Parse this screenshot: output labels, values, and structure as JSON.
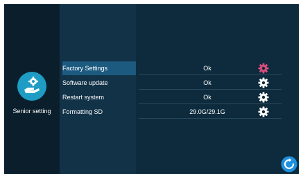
{
  "sidebar": {
    "label": "Senior setting",
    "icon": "settings-hand-icon"
  },
  "rows": [
    {
      "label": "Factory Settings",
      "value": "Ok",
      "icon": "gear-icon",
      "selected": true,
      "icon_color": "#d94c7a"
    },
    {
      "label": "Software update",
      "value": "Ok",
      "icon": "gear-icon",
      "selected": false,
      "icon_color": "#ffffff"
    },
    {
      "label": "Restart system",
      "value": "Ok",
      "icon": "gear-icon",
      "selected": false,
      "icon_color": "#ffffff"
    },
    {
      "label": "Formatting SD",
      "value": "29.0G/29.1G",
      "icon": "gear-icon",
      "selected": false,
      "icon_color": "#ffffff"
    }
  ],
  "refresh": {
    "icon": "refresh-icon",
    "color": "#1e90e0"
  },
  "colors": {
    "accent": "#1c5a80",
    "background": "#0b2a3b"
  }
}
